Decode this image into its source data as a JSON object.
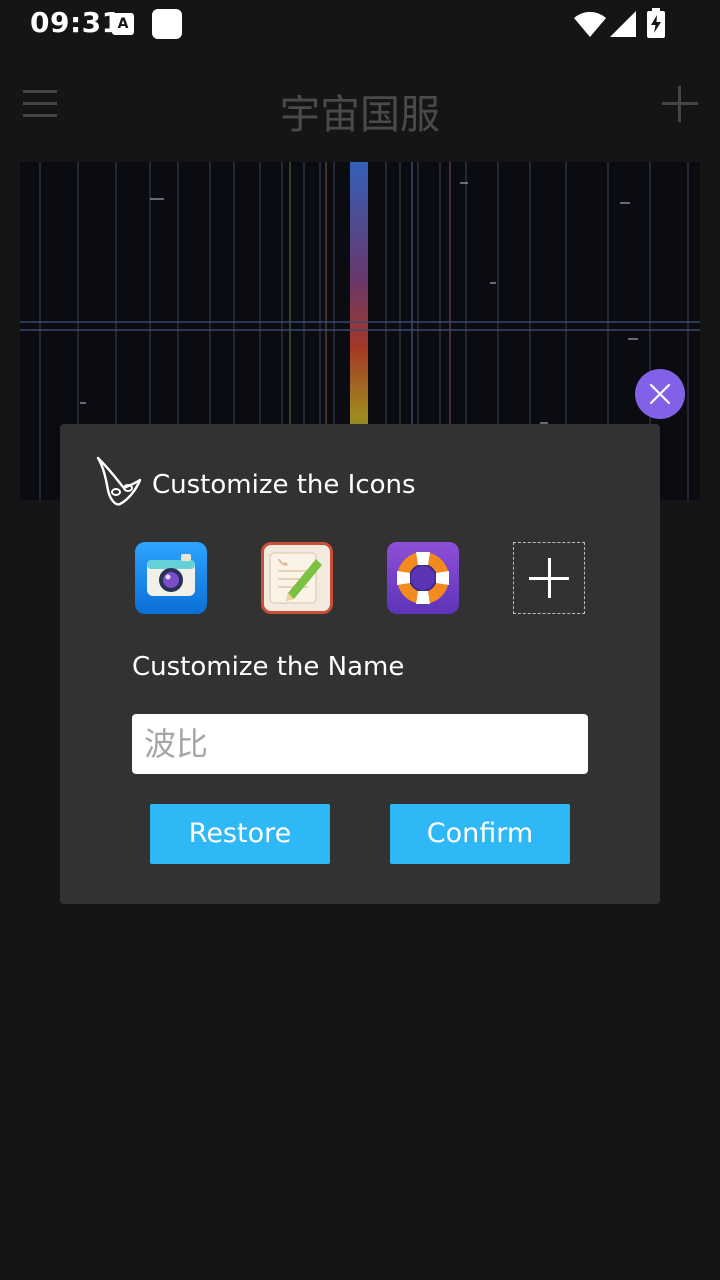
{
  "status_bar": {
    "time": "09:31",
    "notif_label": "A"
  },
  "app_bar": {
    "title": "宇宙国服"
  },
  "dialog": {
    "title": "Customize the Icons",
    "icons": [
      "camera-app-icon",
      "notes-app-icon",
      "lifebuoy-app-icon",
      "add-icon"
    ],
    "name_label": "Customize the Name",
    "name_placeholder": "波比",
    "restore_label": "Restore",
    "confirm_label": "Confirm"
  },
  "colors": {
    "accent": "#2fb8f6",
    "close_button": "#8360e8",
    "dialog_bg": "#323232",
    "page_bg": "#151515"
  }
}
